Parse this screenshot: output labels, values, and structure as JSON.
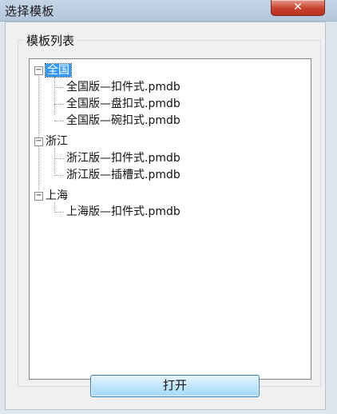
{
  "window": {
    "title": "选择模板",
    "close_glyph": "✕"
  },
  "group": {
    "label": "模板列表"
  },
  "tree": {
    "nodes": [
      {
        "label": "全国",
        "selected": true,
        "children": [
          "全国版—扣件式.pmdb",
          "全国版—盘扣式.pmdb",
          "全国版—碗扣式.pmdb"
        ]
      },
      {
        "label": "浙江",
        "selected": false,
        "children": [
          "浙江版—扣件式.pmdb",
          "浙江版—插槽式.pmdb"
        ]
      },
      {
        "label": "上海",
        "selected": false,
        "children": [
          "上海版—扣件式.pmdb"
        ]
      }
    ],
    "expander_glyph": "−"
  },
  "actions": {
    "open_label": "打开"
  }
}
